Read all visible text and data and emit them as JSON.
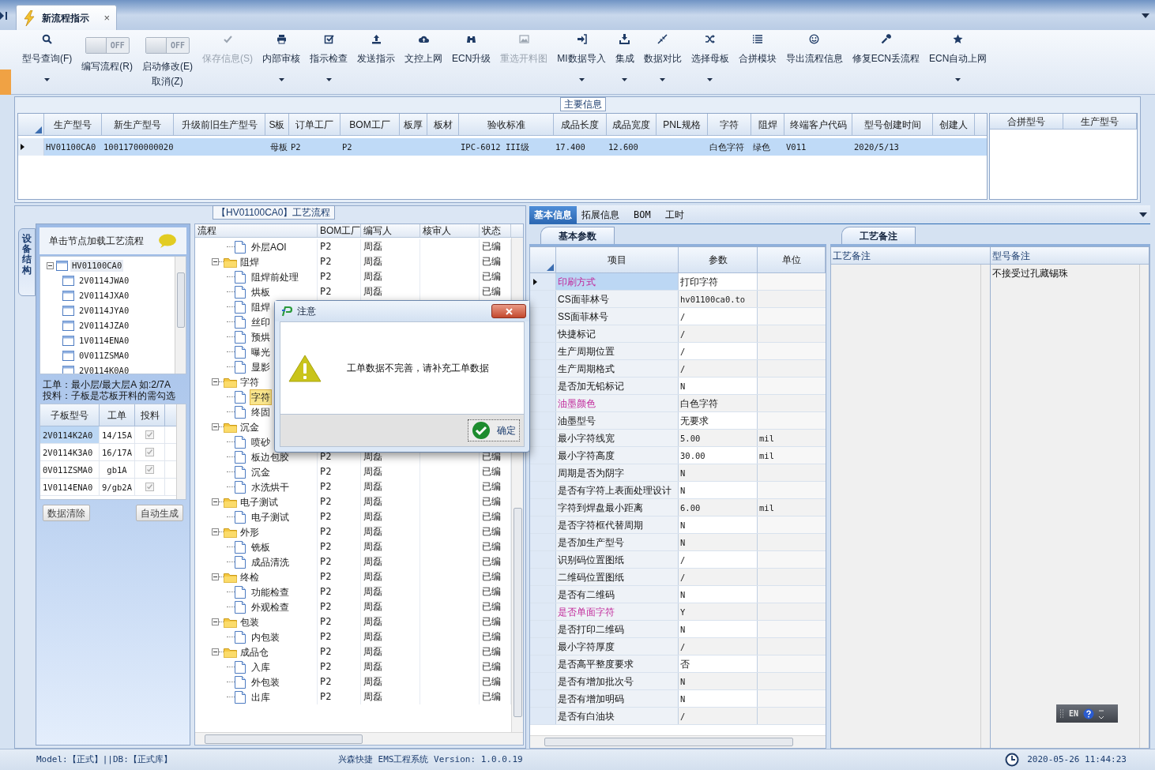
{
  "doc_tab": {
    "label": "新流程指示",
    "close": "×",
    "selected": true
  },
  "toolbar": [
    {
      "kind": "button",
      "label": "型号查询(F)",
      "disabled": false,
      "dropdown": true
    },
    {
      "kind": "toggle",
      "label": "编写流程(R)",
      "switch_text": "OFF",
      "on": false
    },
    {
      "kind": "toggle",
      "label": "启动修改(E)",
      "switch_text": "OFF",
      "on": false,
      "sublabel": "取消(Z)"
    },
    {
      "kind": "button",
      "label": "保存信息(S)",
      "disabled": true,
      "dropdown": false
    },
    {
      "kind": "button",
      "label": "内部审核",
      "disabled": false,
      "dropdown": true
    },
    {
      "kind": "button",
      "label": "指示检查",
      "disabled": false,
      "dropdown": true
    },
    {
      "kind": "button",
      "label": "发送指示",
      "disabled": false,
      "dropdown": false
    },
    {
      "kind": "button",
      "label": "文控上网",
      "disabled": false,
      "dropdown": false
    },
    {
      "kind": "button",
      "label": "ECN升级",
      "disabled": false,
      "dropdown": false
    },
    {
      "kind": "button",
      "label": "重选开料图",
      "disabled": true,
      "dropdown": false
    },
    {
      "kind": "button",
      "label": "MI数据导入",
      "disabled": false,
      "dropdown": true
    },
    {
      "kind": "button",
      "label": "集成",
      "disabled": false,
      "dropdown": true
    },
    {
      "kind": "button",
      "label": "数据对比",
      "disabled": false,
      "dropdown": true
    },
    {
      "kind": "button",
      "label": "选择母板",
      "disabled": false,
      "dropdown": true
    },
    {
      "kind": "button",
      "label": "合拼模块",
      "disabled": false,
      "dropdown": false
    },
    {
      "kind": "button",
      "label": "导出流程信息",
      "disabled": false,
      "dropdown": false
    },
    {
      "kind": "button",
      "label": "修复ECN丢流程",
      "disabled": false,
      "dropdown": false
    },
    {
      "kind": "button",
      "label": "ECN自动上网",
      "disabled": false,
      "dropdown": true
    }
  ],
  "main_info": {
    "title": "主要信息",
    "columns": [
      "生产型号",
      "新生产型号",
      "升级前旧生产型号",
      "S板",
      "订单工厂",
      "BOM工厂",
      "板厚",
      "板材",
      "验收标准",
      "成品长度",
      "成品宽度",
      "PNL规格",
      "字符",
      "阻焊",
      "终端客户代码",
      "型号创建时间",
      "创建人"
    ],
    "rows": [
      {
        "selected": true,
        "cells": [
          "HV01100CA0",
          "10011700000020",
          null,
          "母板",
          "P2",
          "P2",
          null,
          null,
          "IPC-6012 III级",
          "17.400",
          "12.600",
          null,
          "白色字符",
          "绿色",
          "V011",
          "2020/5/13",
          null
        ]
      }
    ],
    "merge_columns": [
      "合拼型号",
      "生产型号"
    ]
  },
  "process_group": {
    "title": "【HV01100CA0】工艺流程",
    "side_tab": "设备结构",
    "hint": "单击节点加载工艺流程",
    "board_tree": {
      "label": "HV01100CA0",
      "expanded": true,
      "selected": true,
      "children": [
        {
          "label": "2V0114JWA0",
          "selected": false
        },
        {
          "label": "2V0114JXA0",
          "selected": false
        },
        {
          "label": "2V0114JYA0",
          "selected": false
        },
        {
          "label": "2V0114JZA0",
          "selected": false
        },
        {
          "label": "1V0114ENA0",
          "selected": false
        },
        {
          "label": "0V011ZSMA0",
          "selected": false
        },
        {
          "label": "2V0114K0A0",
          "selected": false
        }
      ]
    },
    "notes": [
      "工单：最小层/最大层A 如:2/7A",
      "投料：子板是芯板开料的需勾选"
    ],
    "sub_columns": [
      "子板型号",
      "工单",
      "投料"
    ],
    "sub_rows": [
      {
        "board": "2V0114K2A0",
        "order": "14/15A",
        "feed": true,
        "selected": true
      },
      {
        "board": "2V0114K3A0",
        "order": "16/17A",
        "feed": true,
        "selected": false
      },
      {
        "board": "0V011ZSMA0",
        "order": "gb1A",
        "feed": true,
        "selected": false
      },
      {
        "board": "1V0114ENA0",
        "order": "9/gb2A",
        "feed": true,
        "selected": false
      }
    ],
    "buttons": [
      "数据清除",
      "自动生成"
    ],
    "flow_columns": [
      "流程",
      "BOM工厂",
      "编写人",
      "核审人",
      "状态"
    ],
    "flow": [
      {
        "kind": "step",
        "label": "外层AOI",
        "bom": "P2",
        "writer": "周磊",
        "status": "已编",
        "selected": false
      },
      {
        "kind": "folder",
        "label": "阻焊",
        "expanded": true,
        "bom": "P2",
        "writer": "周磊",
        "status": "已编",
        "selected": false,
        "children": [
          {
            "kind": "step",
            "label": "阻焊前处理",
            "bom": "P2",
            "writer": "周磊",
            "status": "已编",
            "selected": false
          },
          {
            "kind": "step",
            "label": "烘板",
            "bom": "P2",
            "writer": "周磊",
            "status": "已编",
            "selected": false
          },
          {
            "kind": "step",
            "label": "阻焊",
            "selected": false
          },
          {
            "kind": "step",
            "label": "丝印",
            "selected": false
          },
          {
            "kind": "step",
            "label": "预烘",
            "selected": false
          },
          {
            "kind": "step",
            "label": "曝光",
            "selected": false
          },
          {
            "kind": "step",
            "label": "显影",
            "selected": false
          }
        ]
      },
      {
        "kind": "folder",
        "label": "字符",
        "expanded": true,
        "selected": false,
        "children": [
          {
            "kind": "step",
            "label": "字符",
            "selected": true
          },
          {
            "kind": "step",
            "label": "终固",
            "selected": false
          }
        ]
      },
      {
        "kind": "folder",
        "label": "沉金",
        "expanded": true,
        "selected": false,
        "children": [
          {
            "kind": "step",
            "label": "喷砂",
            "selected": false
          },
          {
            "kind": "step",
            "label": "板边包胶",
            "bom": "P2",
            "writer": "周磊",
            "status": "已编",
            "selected": false
          },
          {
            "kind": "step",
            "label": "沉金",
            "bom": "P2",
            "writer": "周磊",
            "status": "已编",
            "selected": false
          },
          {
            "kind": "step",
            "label": "水洗烘干",
            "bom": "P2",
            "writer": "周磊",
            "status": "已编",
            "selected": false
          }
        ]
      },
      {
        "kind": "folder",
        "label": "电子测试",
        "expanded": true,
        "bom": "P2",
        "writer": "周磊",
        "status": "已编",
        "selected": false,
        "children": [
          {
            "kind": "step",
            "label": "电子测试",
            "bom": "P2",
            "writer": "周磊",
            "status": "已编",
            "selected": false
          }
        ]
      },
      {
        "kind": "folder",
        "label": "外形",
        "expanded": true,
        "bom": "P2",
        "writer": "周磊",
        "status": "已编",
        "selected": false,
        "children": [
          {
            "kind": "step",
            "label": "铣板",
            "bom": "P2",
            "writer": "周磊",
            "status": "已编",
            "selected": false
          },
          {
            "kind": "step",
            "label": "成品清洗",
            "bom": "P2",
            "writer": "周磊",
            "status": "已编",
            "selected": false
          }
        ]
      },
      {
        "kind": "folder",
        "label": "终检",
        "expanded": true,
        "bom": "P2",
        "writer": "周磊",
        "status": "已编",
        "selected": false,
        "children": [
          {
            "kind": "step",
            "label": "功能检查",
            "bom": "P2",
            "writer": "周磊",
            "status": "已编",
            "selected": false
          },
          {
            "kind": "step",
            "label": "外观检查",
            "bom": "P2",
            "writer": "周磊",
            "status": "已编",
            "selected": false
          }
        ]
      },
      {
        "kind": "folder",
        "label": "包装",
        "expanded": true,
        "bom": "P2",
        "writer": "周磊",
        "status": "已编",
        "selected": false,
        "children": [
          {
            "kind": "step",
            "label": "内包装",
            "bom": "P2",
            "writer": "周磊",
            "status": "已编",
            "selected": false
          }
        ]
      },
      {
        "kind": "folder",
        "label": "成品仓",
        "expanded": true,
        "bom": "P2",
        "writer": "周磊",
        "status": "已编",
        "selected": false,
        "children": [
          {
            "kind": "step",
            "label": "入库",
            "bom": "P2",
            "writer": "周磊",
            "status": "已编",
            "selected": false
          },
          {
            "kind": "step",
            "label": "外包装",
            "bom": "P2",
            "writer": "周磊",
            "status": "已编",
            "selected": false
          },
          {
            "kind": "step",
            "label": "出库",
            "bom": "P2",
            "writer": "周磊",
            "status": "已编",
            "selected": false
          }
        ]
      }
    ]
  },
  "detail_tabs": [
    {
      "label": "基本信息",
      "selected": true
    },
    {
      "label": "拓展信息",
      "selected": false
    },
    {
      "label": "BOM",
      "selected": false
    },
    {
      "label": "工时",
      "selected": false
    }
  ],
  "params": {
    "tab": "基本参数",
    "columns": [
      "项目",
      "参数",
      "单位"
    ],
    "rows": [
      {
        "item": "印刷方式",
        "value": "打印字符",
        "highlight": true,
        "selected": true
      },
      {
        "item": "CS面菲林号",
        "value": "hv01100ca0.to",
        "highlight": false,
        "selected": false
      },
      {
        "item": "SS面菲林号",
        "value": "/",
        "highlight": false,
        "selected": false
      },
      {
        "item": "快捷标记",
        "value": "/",
        "highlight": false,
        "selected": false
      },
      {
        "item": "生产周期位置",
        "value": "/",
        "highlight": false,
        "selected": false
      },
      {
        "item": "生产周期格式",
        "value": "/",
        "highlight": false,
        "selected": false
      },
      {
        "item": "是否加无铅标记",
        "value": "N",
        "highlight": false,
        "selected": false
      },
      {
        "item": "油墨颜色",
        "value": "白色字符",
        "highlight": true,
        "selected": false
      },
      {
        "item": "油墨型号",
        "value": "无要求",
        "highlight": false,
        "selected": false
      },
      {
        "item": "最小字符线宽",
        "value": "5.00",
        "unit": "mil",
        "highlight": false,
        "selected": false
      },
      {
        "item": "最小字符高度",
        "value": "30.00",
        "unit": "mil",
        "highlight": false,
        "selected": false
      },
      {
        "item": "周期是否为阴字",
        "value": "N",
        "highlight": false,
        "selected": false
      },
      {
        "item": "是否有字符上表面处理设计",
        "value": "N",
        "highlight": false,
        "selected": false
      },
      {
        "item": "字符到焊盘最小距离",
        "value": "6.00",
        "unit": "mil",
        "highlight": false,
        "selected": false
      },
      {
        "item": "是否字符框代替周期",
        "value": "N",
        "highlight": false,
        "selected": false
      },
      {
        "item": "是否加生产型号",
        "value": "N",
        "highlight": false,
        "selected": false
      },
      {
        "item": "识别码位置图纸",
        "value": "/",
        "highlight": false,
        "selected": false
      },
      {
        "item": "二维码位置图纸",
        "value": "/",
        "highlight": false,
        "selected": false
      },
      {
        "item": "是否有二维码",
        "value": "N",
        "highlight": false,
        "selected": false
      },
      {
        "item": "是否单面字符",
        "value": "Y",
        "highlight": true,
        "selected": false
      },
      {
        "item": "是否打印二维码",
        "value": "N",
        "highlight": false,
        "selected": false
      },
      {
        "item": "最小字符厚度",
        "value": "/",
        "highlight": false,
        "selected": false
      },
      {
        "item": "是否高平整度要求",
        "value": "否",
        "highlight": false,
        "selected": false
      },
      {
        "item": "是否有增加批次号",
        "value": "N",
        "highlight": false,
        "selected": false
      },
      {
        "item": "是否有增加明码",
        "value": "N",
        "highlight": false,
        "selected": false
      },
      {
        "item": "是否有白油块",
        "value": "/",
        "highlight": false,
        "selected": false
      }
    ]
  },
  "remarks": {
    "tab": "工艺备注",
    "columns": [
      "工艺备注",
      "型号备注"
    ],
    "model_remark": "不接受过孔藏锡珠"
  },
  "ime": {
    "label": "EN"
  },
  "dialog": {
    "title": "注意",
    "message": "工单数据不完善，请补充工单数据",
    "button": "确定"
  },
  "status_bar": {
    "left": "Model:【正式】||DB:【正式库】",
    "center": "兴森快捷 EMS工程系统 Version: 1.0.0.19",
    "time": "2020-05-26 11:44:23"
  }
}
